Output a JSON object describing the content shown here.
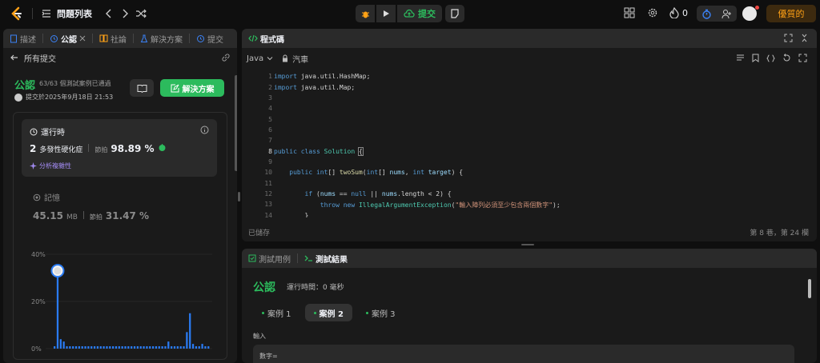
{
  "topnav": {
    "problem_list": "問題列表",
    "submit": "提交",
    "streak": "0",
    "premium": "優質的"
  },
  "left_tabs": [
    "描述",
    "公認",
    "社論",
    "解決方案",
    "提交"
  ],
  "submission": {
    "back_label": "所有提交",
    "status": "公認",
    "passed": "63/63 個測試案例已通過",
    "submitted_at": "提交於2025年9月18日 21:53",
    "solution_button": "解決方案"
  },
  "runtime": {
    "title": "運行時",
    "value": "2",
    "unit": "多發性硬化症",
    "beats_label": "節拍",
    "beats": "98.89 %",
    "complexity": "分析複雜性"
  },
  "memory": {
    "title": "記憶",
    "value": "45.15",
    "unit": "MB",
    "beats_label": "節拍",
    "beats": "31.47 %"
  },
  "chart_data": {
    "type": "bar",
    "ylim": [
      0,
      40
    ],
    "yticks": [
      "40%",
      "20%",
      "0%"
    ],
    "values": [
      1,
      35,
      4,
      3,
      1,
      1,
      1,
      1,
      1,
      1,
      1,
      1,
      1,
      1,
      1,
      1,
      1,
      1,
      1,
      1,
      1,
      1,
      1,
      1,
      1,
      1,
      1,
      1,
      1,
      1,
      1,
      1,
      1,
      1,
      1,
      1,
      1,
      3,
      1,
      1,
      1,
      1,
      1,
      7,
      15,
      2,
      1,
      1,
      2,
      1,
      1
    ],
    "highlight_index": 1,
    "highlight_value": 33
  },
  "code": {
    "tab_title": "程式碼",
    "language": "Java",
    "mode": "汽車",
    "lines": [
      "import java.util.HashMap;",
      "import java.util.Map;",
      "",
      "",
      "",
      "",
      "",
      "public class Solution {",
      "",
      "    public int[] twoSum(int[] nums, int target) {",
      "",
      "        if (nums == null || nums.length < 2) {",
      "            throw new IllegalArgumentException(\"輸入陣列必須至少包含兩個數字\");",
      "        }"
    ],
    "saved": "已儲存",
    "cursor": "第 8 巷，第 24 欄"
  },
  "testpanel": {
    "tab_cases": "測試用例",
    "tab_result": "測試結果",
    "status": "公認",
    "runtime": "運行時間：0 毫秒",
    "cases": [
      "案例 1",
      "案例 2",
      "案例 3"
    ],
    "active_case": 1,
    "input_label": "輸入",
    "input_first": "數字="
  },
  "colors": {
    "accent_green": "#2cbb5d",
    "premium_orange": "#ffa116",
    "bar_blue": "#2a7bf3",
    "purple": "#a48cf5"
  }
}
